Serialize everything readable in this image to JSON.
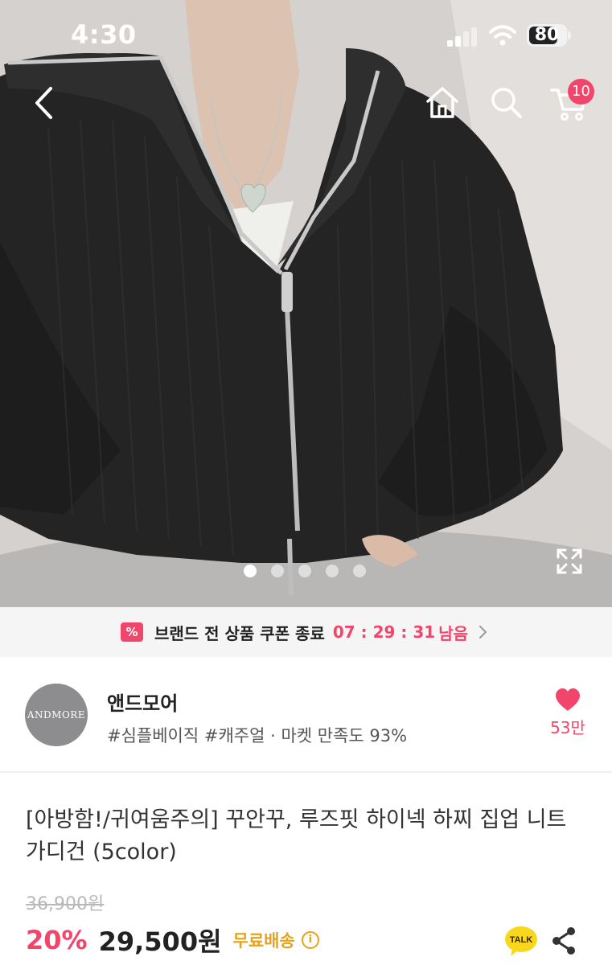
{
  "status_bar": {
    "time": "4:30",
    "battery": "80",
    "battery_level": 0.8
  },
  "header": {
    "icons": [
      "chevron-left-icon",
      "home-icon",
      "search-icon",
      "cart-icon"
    ],
    "cart_badge": "10"
  },
  "gallery": {
    "image_count": 5,
    "active_index": 0
  },
  "coupon_bar": {
    "icon_glyph": "%",
    "text": "브랜드 전 상품 쿠폰 종료",
    "timer": "07 : 29 : 31",
    "suffix": "남음"
  },
  "shop": {
    "logo_text": "ANDMORE",
    "name": "앤드모어",
    "tags": "#심플베이직 #캐주얼 · 마켓 만족도 93%",
    "likes": "53만"
  },
  "product": {
    "title": "[아방함!/귀여움주의] 꾸안꾸, 루즈핏 하이넥 하찌 집업 니트 가디건 (5color)",
    "original_price": "36,900원",
    "discount": "20%",
    "price": "29,500원",
    "shipping": "무료배송",
    "info_glyph": "i"
  },
  "actions": {
    "talk_label": "TALK"
  },
  "colors": {
    "accent": "#f2456b",
    "shipping": "#e8a21a"
  }
}
